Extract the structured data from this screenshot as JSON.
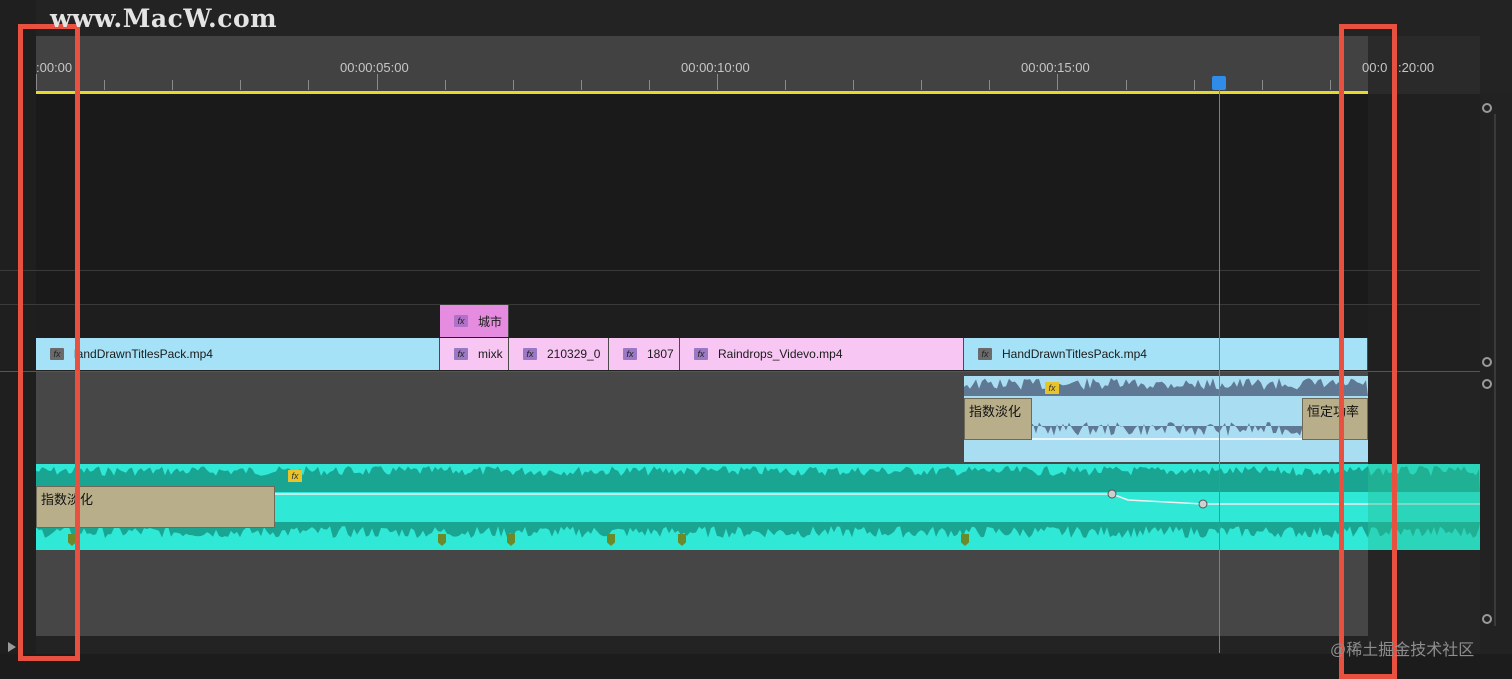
{
  "watermark": "www.MacW.com",
  "timecodes": [
    ":00:00",
    "00:00:05:00",
    "00:00:10:00",
    "00:00:15:00",
    "00:0",
    ":20:00"
  ],
  "video_clips": {
    "v2": {
      "label": "城市",
      "fx": "fx"
    },
    "v1": [
      {
        "label": "landDrawnTitlesPack.mp4",
        "fx": "fx"
      },
      {
        "label": "mixk",
        "fx": "fx"
      },
      {
        "label": "210329_0",
        "fx": "fx"
      },
      {
        "label": "1807",
        "fx": "fx"
      },
      {
        "label": "Raindrops_Videvo.mp4",
        "fx": "fx"
      },
      {
        "label": "HandDrawnTitlesPack.mp4",
        "fx": "fx"
      }
    ]
  },
  "audio": {
    "a1_fade_in": "指数淡化",
    "a1_fade_out": "恒定功率",
    "a2_fade_in": "指数淡化",
    "fx": "fx"
  },
  "credit": "@稀土掘金技术社区",
  "colors": {
    "playhead": "#2f8ce8",
    "work_area": "#e5d82e",
    "highlight": "#e8503f",
    "audio_green": "#2fe8d6"
  }
}
